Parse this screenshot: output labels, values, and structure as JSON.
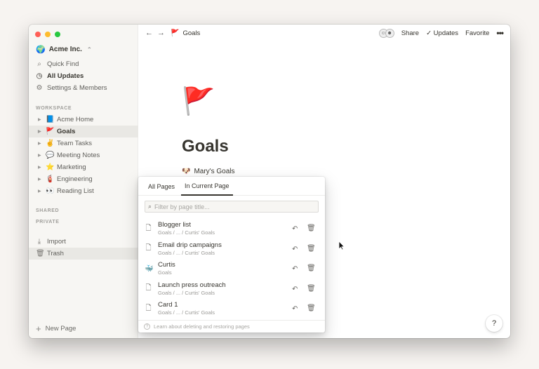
{
  "sidebar": {
    "workspace": "Acme Inc.",
    "nav": [
      {
        "label": "Quick Find",
        "icon": "search-icon"
      },
      {
        "label": "All Updates",
        "icon": "clock-icon"
      },
      {
        "label": "Settings & Members",
        "icon": "gear-icon"
      }
    ],
    "workspace_label": "WORKSPACE",
    "pages": [
      {
        "label": "Acme Home",
        "emoji": "📘"
      },
      {
        "label": "Goals",
        "emoji": "🚩"
      },
      {
        "label": "Team Tasks",
        "emoji": "✌️"
      },
      {
        "label": "Meeting Notes",
        "emoji": "💬"
      },
      {
        "label": "Marketing",
        "emoji": "⭐"
      },
      {
        "label": "Engineering",
        "emoji": "🧯"
      },
      {
        "label": "Reading List",
        "emoji": "👀"
      }
    ],
    "shared_label": "SHARED",
    "private_label": "PRIVATE",
    "import_label": "Import",
    "trash_label": "Trash",
    "new_page_label": "New Page"
  },
  "topbar": {
    "crumb_title": "Goals",
    "share_label": "Share",
    "updates_label": "Updates",
    "favorite_label": "Favorite"
  },
  "page": {
    "icon": "🚩",
    "title": "Goals",
    "subpage_emoji": "🐶",
    "subpage_label": "Mary's Goals"
  },
  "trash_popup": {
    "tabs": [
      "All Pages",
      "In Current Page"
    ],
    "active_tab": "In Current Page",
    "filter_placeholder": "Filter by page title...",
    "items": [
      {
        "title": "Blogger list",
        "path": "Goals / ... / Curtis' Goals",
        "icon": "page-icon"
      },
      {
        "title": "Email drip campaigns",
        "path": "Goals / ... / Curtis' Goals",
        "icon": "page-icon"
      },
      {
        "title": "Curtis",
        "path": "Goals",
        "icon": "whale-icon"
      },
      {
        "title": "Launch press outreach",
        "path": "Goals / ... / Curtis' Goals",
        "icon": "page-icon"
      },
      {
        "title": "Card 1",
        "path": "Goals / ... / Curtis' Goals",
        "icon": "page-icon"
      }
    ],
    "learn_label": "Learn about deleting and restoring pages"
  },
  "help_label": "?"
}
